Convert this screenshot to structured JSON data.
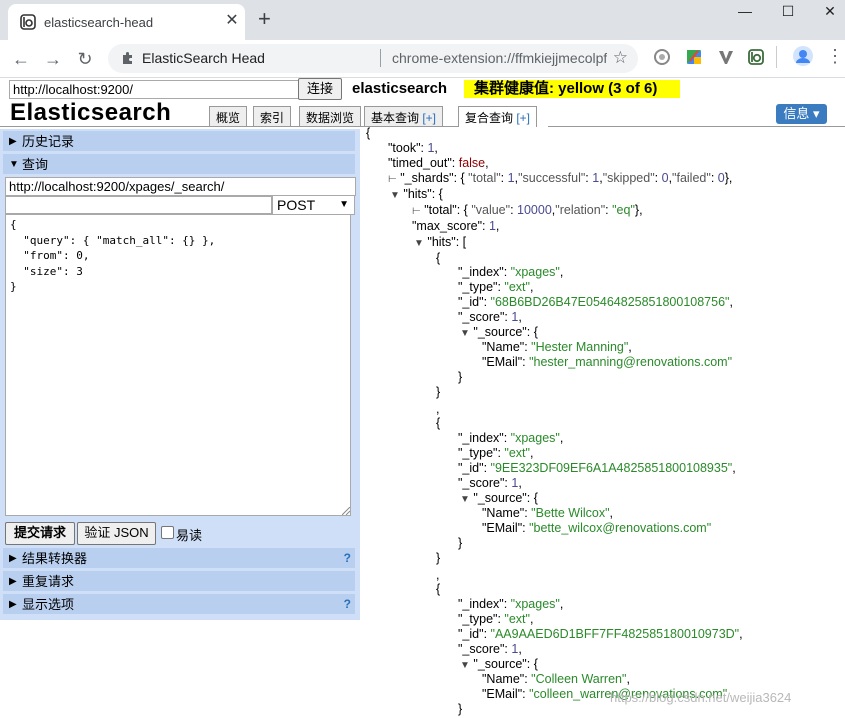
{
  "browser": {
    "tab_title": "elasticsearch-head",
    "tab_close": "✕",
    "new_tab": "+",
    "win_min": "—",
    "win_max": "☐",
    "win_close": "✕",
    "omnibox_site": "ElasticSearch Head",
    "omnibox_url": "chrome-extension://ffmkiejjmecolpfloofpjolo...",
    "star": "☆"
  },
  "head": {
    "connect_url": "http://localhost:9200/",
    "connect_label": "连接",
    "cluster_name": "elasticsearch",
    "health": "集群健康值: yellow (3 of 6)",
    "brand": "Elasticsearch",
    "tabs": [
      "概览",
      "索引",
      "数据浏览",
      "基本查询 ",
      "复合查询 "
    ],
    "tab_plus": "[+]",
    "info_label": "信息 ▾",
    "colors": {
      "health": "#ffff00",
      "panel": "#cfdff7",
      "section": "#b9cff0",
      "info": "#3b7bbf"
    }
  },
  "query_panel": {
    "history_label": "历史记录",
    "query_label": "查询",
    "url": "http://localhost:9200/xpages/_search/",
    "path": "",
    "method": "POST",
    "body": "{\n  \"query\": { \"match_all\": {} },\n  \"from\": 0,\n  \"size\": 3\n}",
    "submit_label": "提交请求",
    "validate_label": "验证 JSON",
    "easy_read_label": "易读",
    "transformer_label": "结果转换器",
    "repeat_label": "重复请求",
    "display_label": "显示选项",
    "help": "?"
  },
  "result": {
    "took": "1",
    "timed_out": "false",
    "shards": {
      "total": "1",
      "successful": "1",
      "skipped": "0",
      "failed": "0"
    },
    "total_value": "10000",
    "total_relation": "\"eq\"",
    "max_score": "1",
    "hits": [
      {
        "index": "\"xpages\"",
        "type": "\"ext\"",
        "id": "\"68B6BD26B47E05464825851800108756\"",
        "score": "1",
        "name": "\"Hester Manning\"",
        "email": "\"hester_manning@renovations.com\""
      },
      {
        "index": "\"xpages\"",
        "type": "\"ext\"",
        "id": "\"9EE323DF09EF6A1A4825851800108935\"",
        "score": "1",
        "name": "\"Bette Wilcox\"",
        "email": "\"bette_wilcox@renovations.com\""
      },
      {
        "index": "\"xpages\"",
        "type": "\"ext\"",
        "id": "\"AA9AAED6D1BFF7FF482585180010973D\"",
        "score": "1",
        "name": "\"Colleen Warren\"",
        "email": "\"colleen_warren@renovations.com\""
      }
    ],
    "watermark": "https://blog.csdn.net/weijia3624"
  }
}
